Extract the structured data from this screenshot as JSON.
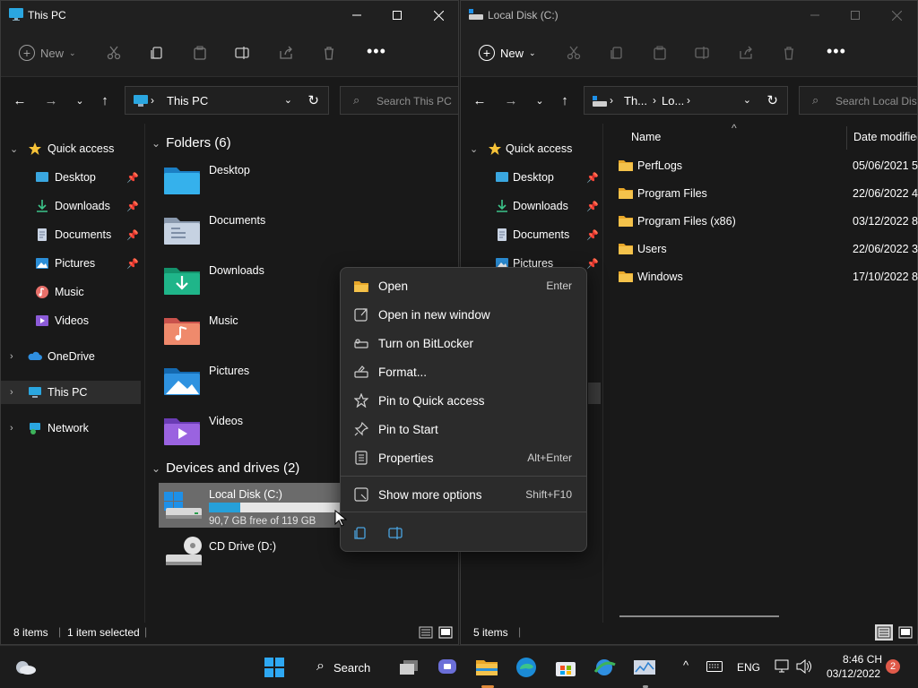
{
  "left_window": {
    "title": "This PC",
    "toolbar": {
      "new_label": "New"
    },
    "address": {
      "path": [
        "This PC"
      ],
      "search_placeholder": "Search This PC"
    },
    "sidebar": [
      {
        "label": "Quick access",
        "icon": "star-icon"
      },
      {
        "label": "Desktop",
        "icon": "desktop-folder-icon",
        "pinned": true
      },
      {
        "label": "Downloads",
        "icon": "download-icon",
        "pinned": true
      },
      {
        "label": "Documents",
        "icon": "documents-icon",
        "pinned": true
      },
      {
        "label": "Pictures",
        "icon": "pictures-icon",
        "pinned": true
      },
      {
        "label": "Music",
        "icon": "music-icon"
      },
      {
        "label": "Videos",
        "icon": "videos-icon"
      },
      {
        "label": "OneDrive",
        "icon": "cloud-icon"
      },
      {
        "label": "This PC",
        "icon": "computer-icon",
        "selected": true
      },
      {
        "label": "Network",
        "icon": "network-icon"
      }
    ],
    "folders_header": "Folders (6)",
    "folders": [
      "Desktop",
      "Documents",
      "Downloads",
      "Music",
      "Pictures",
      "Videos"
    ],
    "drives_header": "Devices and drives (2)",
    "drives": [
      {
        "name": "Local Disk (C:)",
        "free_text": "90,7 GB free of 119 GB",
        "used_fraction": 0.24,
        "selected": true
      },
      {
        "name": "CD Drive (D:)"
      }
    ],
    "status": {
      "items": "8 items",
      "selected": "1 item selected"
    }
  },
  "right_window": {
    "title": "Local Disk (C:)",
    "toolbar": {
      "new_label": "New"
    },
    "address": {
      "path": [
        "Th...",
        "Lo..."
      ],
      "search_placeholder": "Search Local Disk"
    },
    "sidebar": [
      {
        "label": "Quick access"
      },
      {
        "label": "Desktop"
      },
      {
        "label": "Downloads"
      },
      {
        "label": "Documents"
      },
      {
        "label": "Pictures"
      }
    ],
    "columns": {
      "name": "Name",
      "date": "Date modified"
    },
    "rows": [
      {
        "name": "PerfLogs",
        "date": "05/06/2021 5:"
      },
      {
        "name": "Program Files",
        "date": "22/06/2022 4:3"
      },
      {
        "name": "Program Files (x86)",
        "date": "03/12/2022 8:4"
      },
      {
        "name": "Users",
        "date": "22/06/2022 3:4"
      },
      {
        "name": "Windows",
        "date": "17/10/2022 8:5"
      }
    ],
    "status": {
      "items": "5 items"
    }
  },
  "context_menu": {
    "items": [
      {
        "label": "Open",
        "shortcut": "Enter",
        "icon": "folder-open-icon"
      },
      {
        "label": "Open in new window",
        "shortcut": "",
        "icon": "open-new-window-icon"
      },
      {
        "label": "Turn on BitLocker",
        "shortcut": "",
        "icon": "bitlocker-key-icon"
      },
      {
        "label": "Format...",
        "shortcut": "",
        "icon": "format-drive-icon"
      },
      {
        "label": "Pin to Quick access",
        "shortcut": "",
        "icon": "star-outline-icon"
      },
      {
        "label": "Pin to Start",
        "shortcut": "",
        "icon": "pin-icon"
      },
      {
        "label": "Properties",
        "shortcut": "Alt+Enter",
        "icon": "properties-icon"
      },
      {
        "label": "Show more options",
        "shortcut": "Shift+F10",
        "icon": "more-options-icon"
      }
    ],
    "bottom_icons": [
      "copy-icon",
      "rename-icon"
    ]
  },
  "taskbar": {
    "search_label": "Search",
    "language": "ENG",
    "time": "8:46 CH",
    "date": "03/12/2022",
    "notification_count": "2"
  },
  "colors": {
    "accent": "#0078d4",
    "folder_yellow": "#f4c24b",
    "drive_bar": "#26a0da",
    "window_bg": "#191919"
  }
}
